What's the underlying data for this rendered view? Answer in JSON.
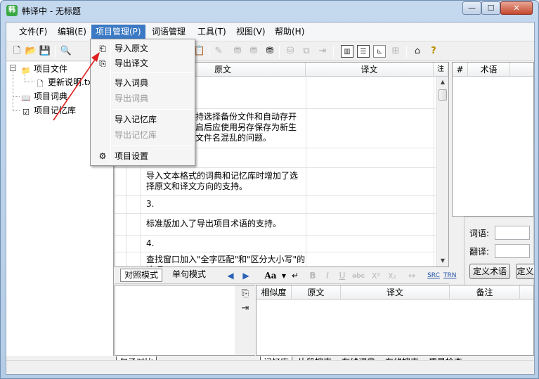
{
  "window": {
    "title": "韩译中 - 无标题",
    "app_icon": "韩",
    "controls": {
      "minimize": "—",
      "maximize": "☐",
      "close": "✕"
    }
  },
  "menubar": {
    "items": [
      "文件(F)",
      "编辑(E)",
      "项目管理(P)",
      "词语管理",
      "工具(T)",
      "视图(V)",
      "帮助(H)"
    ]
  },
  "toolbar": {
    "sel_mode": "SRC",
    "trn_mode": "TRN"
  },
  "dropdown": {
    "items": [
      {
        "label": "导入原文",
        "icon": "import-source-icon",
        "enabled": true
      },
      {
        "label": "导出译文",
        "icon": "export-translation-icon",
        "enabled": true
      },
      {
        "label": "导入词典",
        "icon": "",
        "enabled": true
      },
      {
        "label": "导出词典",
        "icon": "",
        "enabled": false
      },
      {
        "label": "导入记忆库",
        "icon": "",
        "enabled": true
      },
      {
        "label": "导出记忆库",
        "icon": "",
        "enabled": false
      },
      {
        "label": "项目设置",
        "icon": "project-settings-icon",
        "enabled": true
      }
    ]
  },
  "tree": {
    "project_files": "项目文件",
    "file_name": "更新说明.txt",
    "project_dict": "项目词典",
    "project_memory": "项目记忆库"
  },
  "grid": {
    "headers": {
      "source": "原文",
      "translation": "译文",
      "status": "注"
    },
    "rows": [
      {
        "source": ""
      },
      {
        "source": "持选择备份文件和自动存开启后应使用另存保存为新生文件名混乱的问题。"
      },
      {
        "source": ""
      },
      {
        "source": "导入文本格式的词典和记忆库时增加了选择原文和译文方向的支持。"
      },
      {
        "source": "3."
      },
      {
        "source": "标准版加入了导出项目术语的支持。"
      },
      {
        "source": "4."
      },
      {
        "source": "查找窗口加入\"全字匹配\"和\"区分大小写\"的选项。"
      }
    ]
  },
  "modebar": {
    "compare_mode": "对照模式",
    "single_mode": "单句模式",
    "font_btn": "Aa",
    "bold": "B",
    "italic": "I",
    "underline": "U",
    "strike": "abc",
    "superscript": "X²",
    "subscript": "X₂",
    "src": "SRC",
    "trn": "TRN"
  },
  "terms": {
    "col_num": "#",
    "col_term": "术语",
    "word_label": "词语:",
    "trans_label": "翻译:",
    "define_btn": "定义术语",
    "define_btn2": "定义"
  },
  "memory": {
    "headers": [
      "相似度",
      "原文",
      "译文",
      "备注"
    ]
  },
  "bottom_tabs_left": [
    "句子对比"
  ],
  "bottom_tabs_right": [
    "记忆库",
    "片段搜索",
    "在线词典",
    "在线搜索",
    "质量检查"
  ]
}
